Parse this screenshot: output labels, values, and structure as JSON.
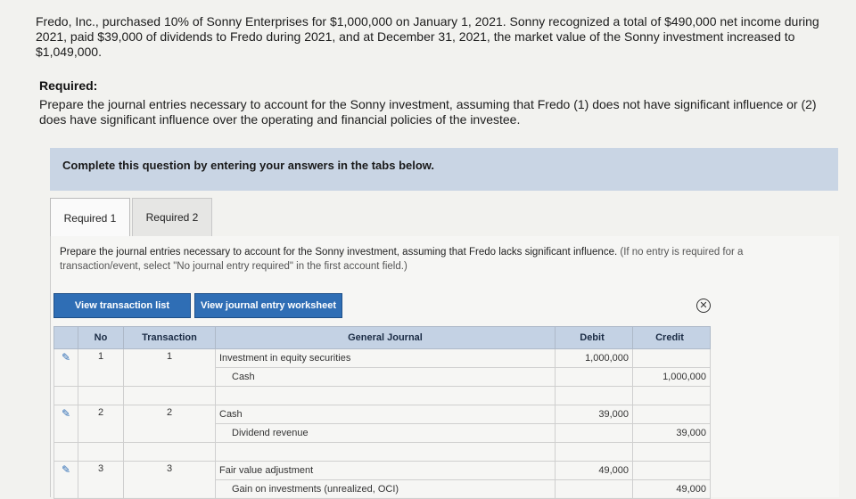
{
  "problem": {
    "text": "Fredo, Inc., purchased 10% of Sonny Enterprises for $1,000,000 on January 1, 2021. Sonny recognized a total of $490,000 net income during 2021, paid $39,000 of dividends to Fredo during 2021, and at December 31, 2021, the market value of the Sonny investment increased to $1,049,000."
  },
  "required": {
    "heading": "Required:",
    "text": "Prepare the journal entries necessary to account for the Sonny investment, assuming that Fredo (1) does not have significant influence or (2) does have significant influence over the operating and financial policies of the investee."
  },
  "banner": {
    "text": "Complete this question by entering your answers in the tabs below."
  },
  "tabs": [
    {
      "label": "Required 1"
    },
    {
      "label": "Required 2"
    }
  ],
  "instruction": {
    "text": "Prepare the journal entries necessary to account for the Sonny investment, assuming that Fredo lacks significant influence.",
    "note": "(If no entry is required for a transaction/event, select \"No journal entry required\" in the first account field.)"
  },
  "buttons": {
    "transaction_list": "View transaction list",
    "journal_worksheet": "View journal entry worksheet"
  },
  "table": {
    "headers": {
      "no": "No",
      "transaction": "Transaction",
      "journal": "General Journal",
      "debit": "Debit",
      "credit": "Credit"
    },
    "entries": [
      {
        "no": "1",
        "transaction": "1",
        "debit_account": "Investment in equity securities",
        "debit": "1,000,000",
        "credit_account": "Cash",
        "credit": "1,000,000"
      },
      {
        "no": "2",
        "transaction": "2",
        "debit_account": "Cash",
        "debit": "39,000",
        "credit_account": "Dividend revenue",
        "credit": "39,000"
      },
      {
        "no": "3",
        "transaction": "3",
        "debit_account": "Fair value adjustment",
        "debit": "49,000",
        "credit_account": "Gain on investments (unrealized, OCI)",
        "credit": "49,000"
      }
    ]
  },
  "icons": {
    "edit": "pencil-icon",
    "close": "close-circle-icon",
    "cursor": "mouse-cursor-icon"
  },
  "colors": {
    "accent": "#2f6eb5",
    "banner": "#c9d5e4",
    "header": "#c4d2e4"
  }
}
